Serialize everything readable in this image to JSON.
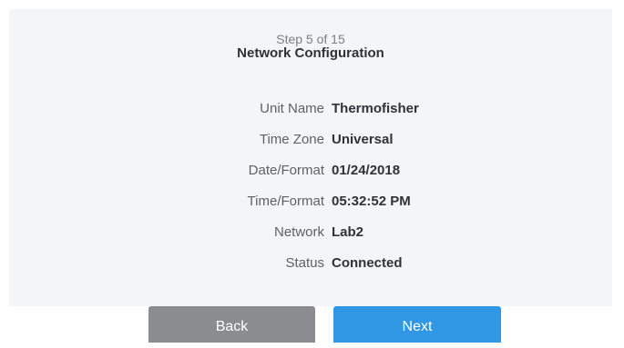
{
  "header": {
    "step": "Step 5 of 15",
    "title": "Network Configuration"
  },
  "fields": [
    {
      "label": "Unit Name",
      "value": "Thermofisher"
    },
    {
      "label": "Time Zone",
      "value": "Universal"
    },
    {
      "label": "Date/Format",
      "value": "01/24/2018"
    },
    {
      "label": "Time/Format",
      "value": "05:32:52 PM"
    },
    {
      "label": "Network",
      "value": "Lab2"
    },
    {
      "label": "Status",
      "value": "Connected"
    }
  ],
  "buttons": {
    "back_label": "Back",
    "next_label": "Next"
  },
  "colors": {
    "panel_background": "#f4f5f6",
    "back_button": "#8a8c8f",
    "next_button": "#2f97e4"
  }
}
